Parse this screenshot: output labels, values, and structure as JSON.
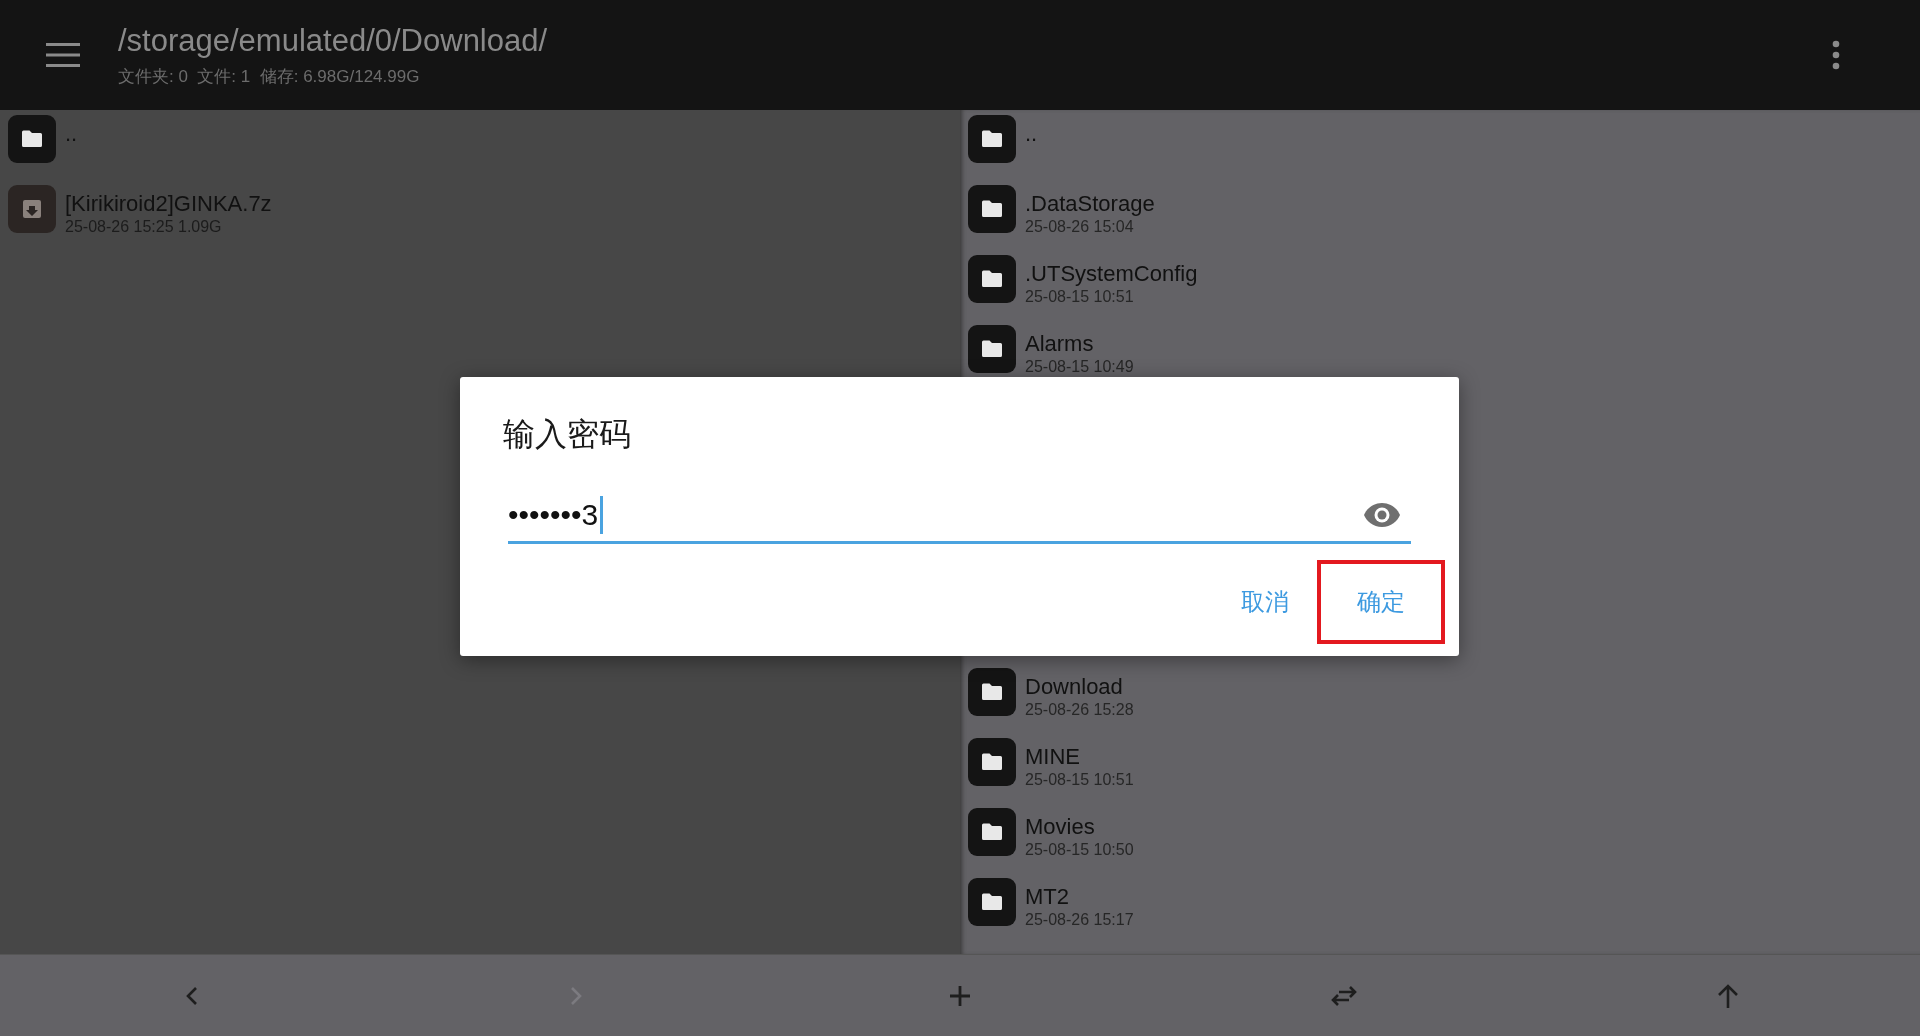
{
  "header": {
    "path": "/storage/emulated/0/Download/",
    "stats": "文件夹: 0  文件: 1  储存: 6.98G/124.99G"
  },
  "left_pane": {
    "items": [
      {
        "kind": "folder",
        "name": ".."
      },
      {
        "kind": "archive",
        "name": "[Kirikiroid2]GINKA.7z",
        "meta": "25-08-26 15:25  1.09G"
      }
    ]
  },
  "right_pane": {
    "items_top": [
      {
        "kind": "folder",
        "name": ".."
      },
      {
        "kind": "folder",
        "name": ".DataStorage",
        "meta": "25-08-26 15:04"
      },
      {
        "kind": "folder",
        "name": ".UTSystemConfig",
        "meta": "25-08-15 10:51"
      },
      {
        "kind": "folder",
        "name": "Alarms",
        "meta": "25-08-15 10:49"
      }
    ],
    "items_bottom": [
      {
        "kind": "folder",
        "name": "Download",
        "meta": "25-08-26 15:28"
      },
      {
        "kind": "folder",
        "name": "MINE",
        "meta": "25-08-15 10:51"
      },
      {
        "kind": "folder",
        "name": "Movies",
        "meta": "25-08-15 10:50"
      },
      {
        "kind": "folder",
        "name": "MT2",
        "meta": "25-08-26 15:17"
      }
    ]
  },
  "dialog": {
    "title": "输入密码",
    "password": {
      "value": "•••••••3",
      "focused": true
    },
    "buttons": [
      {
        "kind": "cancel",
        "label": "取消",
        "highlighted": false
      },
      {
        "kind": "confirm",
        "label": "确定",
        "highlighted": true
      }
    ]
  },
  "bottom_bar": [
    {
      "kind": "back",
      "disabled": false
    },
    {
      "kind": "forward",
      "disabled": true
    },
    {
      "kind": "add",
      "disabled": false
    },
    {
      "kind": "swap",
      "disabled": false
    },
    {
      "kind": "up",
      "disabled": false
    }
  ]
}
